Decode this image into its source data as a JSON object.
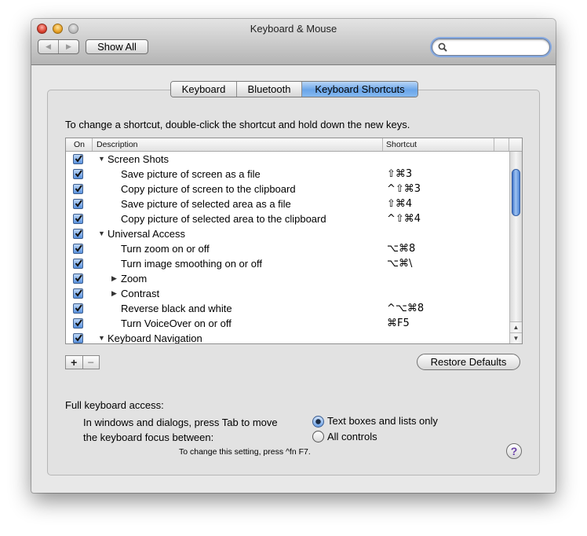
{
  "window": {
    "title": "Keyboard & Mouse"
  },
  "toolbar": {
    "back_glyph": "◀",
    "forward_glyph": "▶",
    "show_all_label": "Show All",
    "search_value": ""
  },
  "tabs": [
    {
      "label": "Keyboard",
      "selected": false
    },
    {
      "label": "Bluetooth",
      "selected": false
    },
    {
      "label": "Keyboard Shortcuts",
      "selected": true
    }
  ],
  "instruction": "To change a shortcut, double-click the shortcut and hold down the new keys.",
  "table": {
    "columns": {
      "on": "On",
      "description": "Description",
      "shortcut": "Shortcut"
    },
    "rows": [
      {
        "checked": true,
        "level": 0,
        "disclosure": "open",
        "description": "Screen Shots",
        "shortcut": ""
      },
      {
        "checked": true,
        "level": 1,
        "disclosure": "",
        "description": "Save picture of screen as a file",
        "shortcut": "⇧⌘3"
      },
      {
        "checked": true,
        "level": 1,
        "disclosure": "",
        "description": "Copy picture of screen to the clipboard",
        "shortcut": "^⇧⌘3"
      },
      {
        "checked": true,
        "level": 1,
        "disclosure": "",
        "description": "Save picture of selected area as a file",
        "shortcut": "⇧⌘4"
      },
      {
        "checked": true,
        "level": 1,
        "disclosure": "",
        "description": "Copy picture of selected area to the clipboard",
        "shortcut": "^⇧⌘4"
      },
      {
        "checked": true,
        "level": 0,
        "disclosure": "open",
        "description": "Universal Access",
        "shortcut": ""
      },
      {
        "checked": true,
        "level": 1,
        "disclosure": "",
        "description": "Turn zoom on or off",
        "shortcut": "⌥⌘8"
      },
      {
        "checked": true,
        "level": 1,
        "disclosure": "",
        "description": "Turn image smoothing on or off",
        "shortcut": "⌥⌘\\"
      },
      {
        "checked": true,
        "level": 1,
        "disclosure": "closed",
        "description": "Zoom",
        "shortcut": ""
      },
      {
        "checked": true,
        "level": 1,
        "disclosure": "closed",
        "description": "Contrast",
        "shortcut": ""
      },
      {
        "checked": true,
        "level": 1,
        "disclosure": "",
        "description": "Reverse black and white",
        "shortcut": "^⌥⌘8"
      },
      {
        "checked": true,
        "level": 1,
        "disclosure": "",
        "description": "Turn VoiceOver on or off",
        "shortcut": "⌘F5"
      },
      {
        "checked": true,
        "level": 0,
        "disclosure": "open",
        "description": "Keyboard Navigation",
        "shortcut": ""
      }
    ]
  },
  "buttons": {
    "add_label": "+",
    "remove_label": "−",
    "restore_defaults_label": "Restore Defaults",
    "help_label": "?"
  },
  "full_keyboard_access": {
    "label": "Full keyboard access:",
    "description_line1": "In windows and dialogs, press Tab to move",
    "description_line2": "the keyboard focus between:",
    "options": [
      {
        "label": "Text boxes and lists only",
        "selected": true
      },
      {
        "label": "All controls",
        "selected": false
      }
    ],
    "hint": "To change this setting, press ^fn F7."
  },
  "colors": {
    "window_bg": "#e8e8e8",
    "selected_tab": "#6aa5e9",
    "checkbox": "#5a93e0",
    "help_glyph": "#6a3fa8"
  }
}
